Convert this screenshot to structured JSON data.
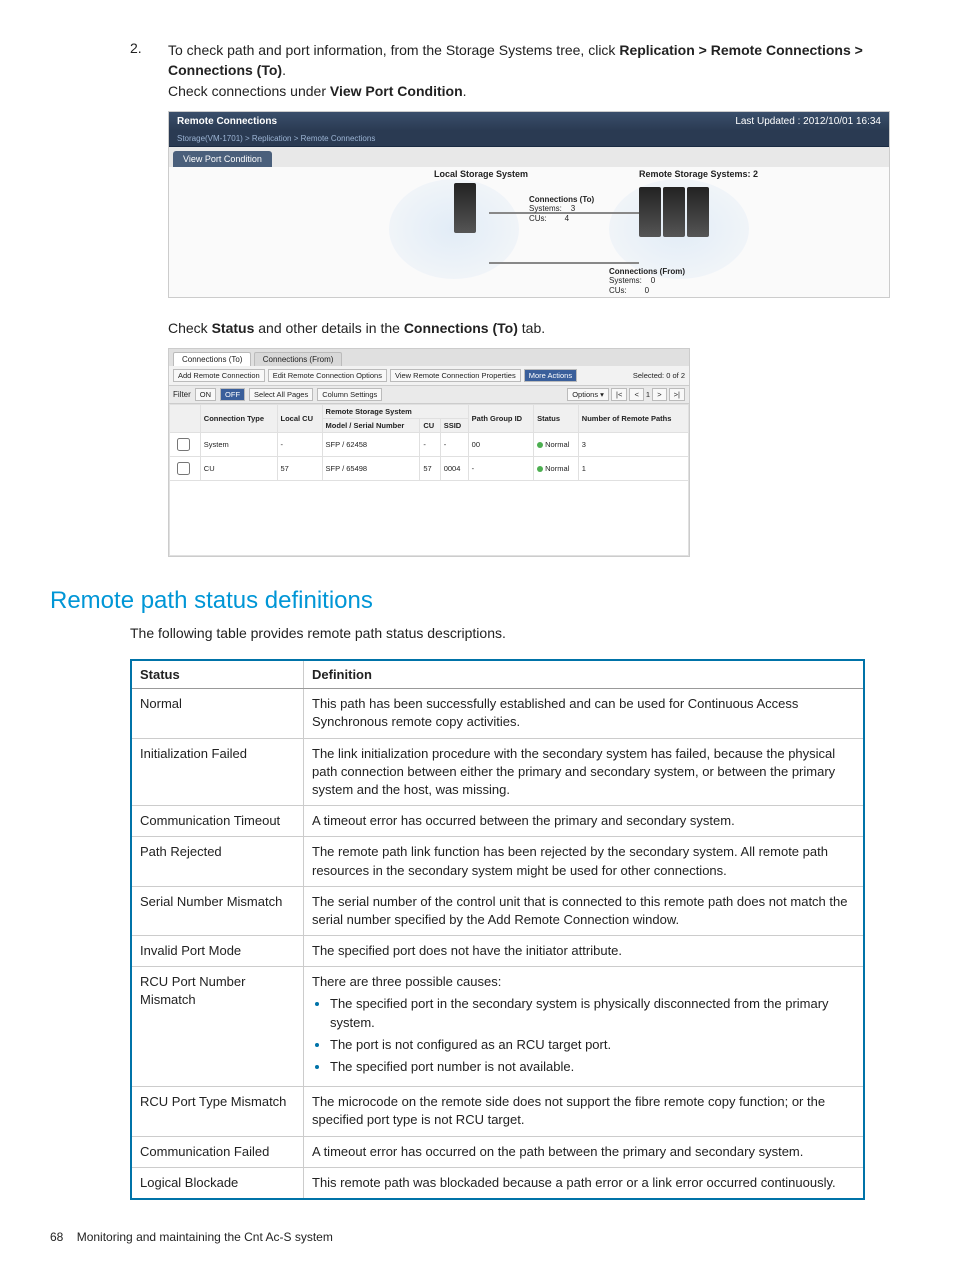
{
  "step": {
    "number": "2.",
    "text_a": "To check path and port information, from the Storage Systems tree, click ",
    "bold_a": "Replication > Remote Connections > Connections (To)",
    "dot": ".",
    "text_b": "Check connections under ",
    "bold_b": "View Port Condition",
    "dot2": "."
  },
  "screenshot1": {
    "title": "Remote Connections",
    "updated": "Last Updated : 2012/10/01 16:34",
    "breadcrumb": "Storage(VM-1701) > Replication > Remote Connections",
    "tab": "View Port Condition",
    "local_label": "Local Storage System",
    "remote_label": "Remote Storage Systems: 2",
    "conn_to": {
      "title": "Connections (To)",
      "systems_label": "Systems:",
      "systems_value": "3",
      "cus_label": "CUs:",
      "cus_value": "4"
    },
    "conn_from": {
      "title": "Connections (From)",
      "systems_label": "Systems:",
      "systems_value": "0",
      "cus_label": "CUs:",
      "cus_value": "0"
    }
  },
  "mid_text": {
    "a": "Check ",
    "b": "Status",
    "c": " and other details in the ",
    "d": "Connections (To)",
    "e": " tab."
  },
  "screenshot2": {
    "tabs": [
      "Connections (To)",
      "Connections (From)"
    ],
    "buttons": [
      "Add Remote Connection",
      "Edit Remote Connection Options",
      "View Remote Connection Properties",
      "More Actions"
    ],
    "selected": "Selected: 0  of  2",
    "filter_label": "Filter",
    "on": "ON",
    "off": "OFF",
    "select_all": "Select All Pages",
    "column_settings": "Column Settings",
    "options": "Options ▾",
    "page": "1",
    "headers_top": [
      "",
      "Connection Type",
      "Local CU",
      "Remote Storage System",
      "",
      "",
      "Path Group ID",
      "Status",
      "Number of Remote Paths"
    ],
    "headers_sub": [
      "",
      "",
      "",
      "Model / Serial Number",
      "CU",
      "SSID",
      "",
      "",
      ""
    ],
    "rows": [
      {
        "type": "System",
        "local_cu": "-",
        "model": "SFP / 62458",
        "cu": "-",
        "ssid": "-",
        "pgid": "00",
        "status": "Normal",
        "paths": "3"
      },
      {
        "type": "CU",
        "local_cu": "57",
        "model": "SFP / 65498",
        "cu": "57",
        "ssid": "0004",
        "pgid": "-",
        "status": "Normal",
        "paths": "1"
      }
    ]
  },
  "section_heading": "Remote path status definitions",
  "section_intro": "The following table provides remote path status descriptions.",
  "status_table": {
    "headers": [
      "Status",
      "Definition"
    ],
    "rows": [
      {
        "status": "Normal",
        "def": "This path has been successfully established and can be used for Continuous Access Synchronous remote copy activities."
      },
      {
        "status": "Initialization Failed",
        "def": "The link initialization procedure with the secondary system has failed, because the physical path connection between either the primary and secondary system, or between the primary system and the host, was missing."
      },
      {
        "status": "Communication Timeout",
        "def": "A timeout error has occurred between the primary and secondary system."
      },
      {
        "status": "Path Rejected",
        "def": "The remote path link function has been rejected by the secondary system. All remote path resources in the secondary system might be used for other connections."
      },
      {
        "status": "Serial Number Mismatch",
        "def": "The serial number of the control unit that is connected to this remote path does not match the serial number specified by the Add Remote Connection window."
      },
      {
        "status": "Invalid Port Mode",
        "def": "The specified port does not have the initiator attribute."
      },
      {
        "status": "RCU Port Number Mismatch",
        "def_lead": "There are three possible causes:",
        "bullets": [
          "The specified port in the secondary system is physically disconnected from the primary system.",
          "The port is not configured as an RCU target port.",
          "The specified port number is not available."
        ]
      },
      {
        "status": "RCU Port Type Mismatch",
        "def": "The microcode on the remote side does not support the fibre remote copy function; or the specified port type is not RCU target."
      },
      {
        "status": "Communication Failed",
        "def": "A timeout error has occurred on the path between the primary and secondary system."
      },
      {
        "status": "Logical Blockade",
        "def": "This remote path was blockaded because a path error or a link error occurred continuously."
      }
    ]
  },
  "footer": {
    "page": "68",
    "text": "Monitoring and maintaining the Cnt Ac-S system"
  }
}
